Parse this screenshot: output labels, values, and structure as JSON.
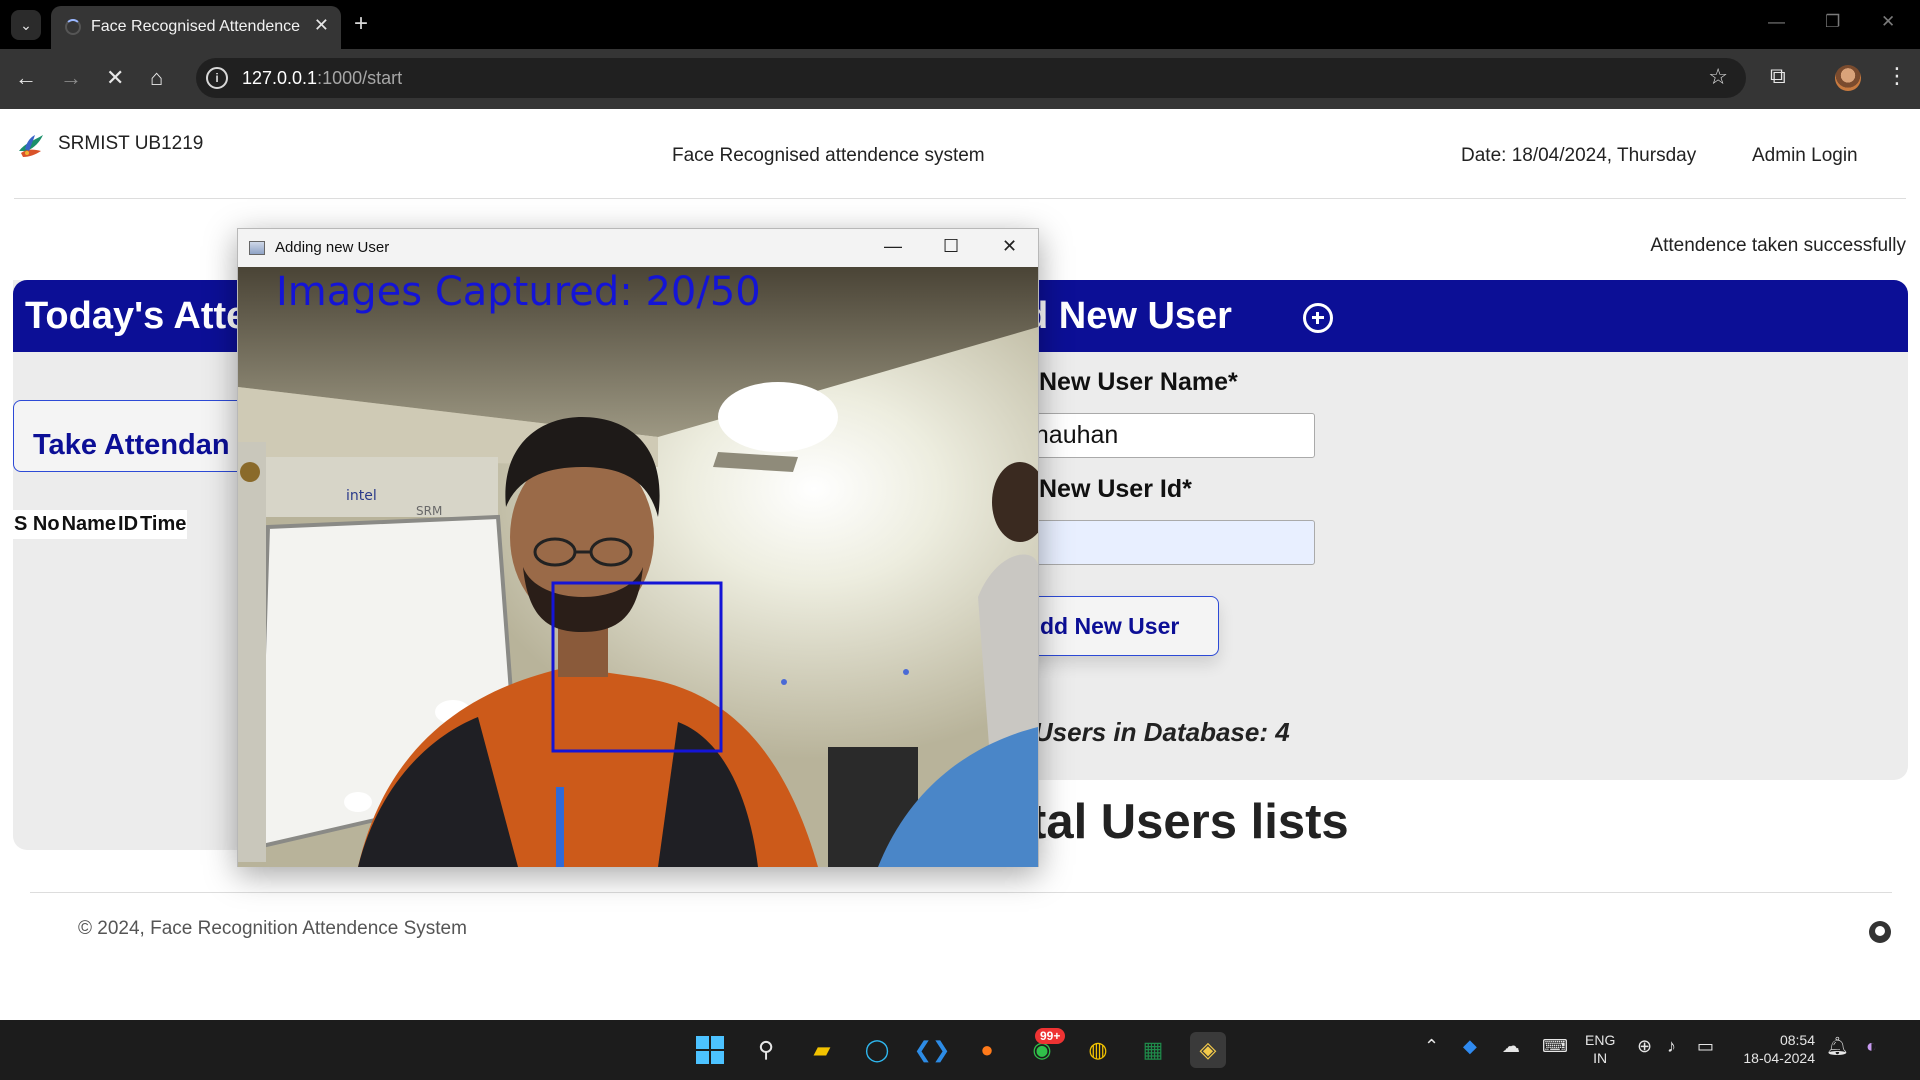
{
  "browser": {
    "tab_title": "Face Recognised Attendence",
    "new_tab_symbol": "+",
    "close_symbol": "✕",
    "url_host": "127.0.0.1",
    "url_path": ":1000/start"
  },
  "header": {
    "brand": "SRMIST UB1219",
    "title": "Face Recognised attendence system",
    "date": "Date: 18/04/2024, Thursday",
    "admin_login": "Admin Login"
  },
  "notice": "Attendence taken successfully",
  "today_panel": {
    "heading": "Today's Atte",
    "take_button": "Take Attendan",
    "table_headers": [
      "S No",
      "Name",
      "ID",
      "Time"
    ]
  },
  "add_panel": {
    "heading": "d New User",
    "name_label": "New User Name*",
    "name_value": "h Chauhan",
    "id_label": "New User Id*",
    "id_value": "",
    "add_button": "dd New User",
    "total_users": "al Users in Database: 4"
  },
  "users_list_heading": "tal Users lists",
  "footer": {
    "copyright": "© 2024, Face Recognition Attendence System"
  },
  "camera_window": {
    "title": "Adding new User",
    "overlay": "Images Captured: 20/50",
    "images_captured": 20,
    "images_total": 50
  },
  "taskbar": {
    "lang_line1": "ENG",
    "lang_line2": "IN",
    "time": "08:54",
    "date": "18-04-2024",
    "whatsapp_badge": "99+"
  },
  "colors": {
    "primary_blue": "#0c0f96",
    "panel_bg": "#ececec",
    "face_box": "#1414d6"
  },
  "icons": [
    "tab-search-icon",
    "back-icon",
    "forward-icon",
    "stop-icon",
    "home-icon",
    "site-info-icon",
    "bookmark-star-icon",
    "extensions-icon",
    "add-user-icon",
    "github-icon",
    "windows-start-icon",
    "search-icon",
    "file-explorer-icon",
    "cortana-icon",
    "vscode-icon",
    "firefox-icon",
    "whatsapp-icon",
    "chrome-icon",
    "excel-icon",
    "python-icon"
  ]
}
